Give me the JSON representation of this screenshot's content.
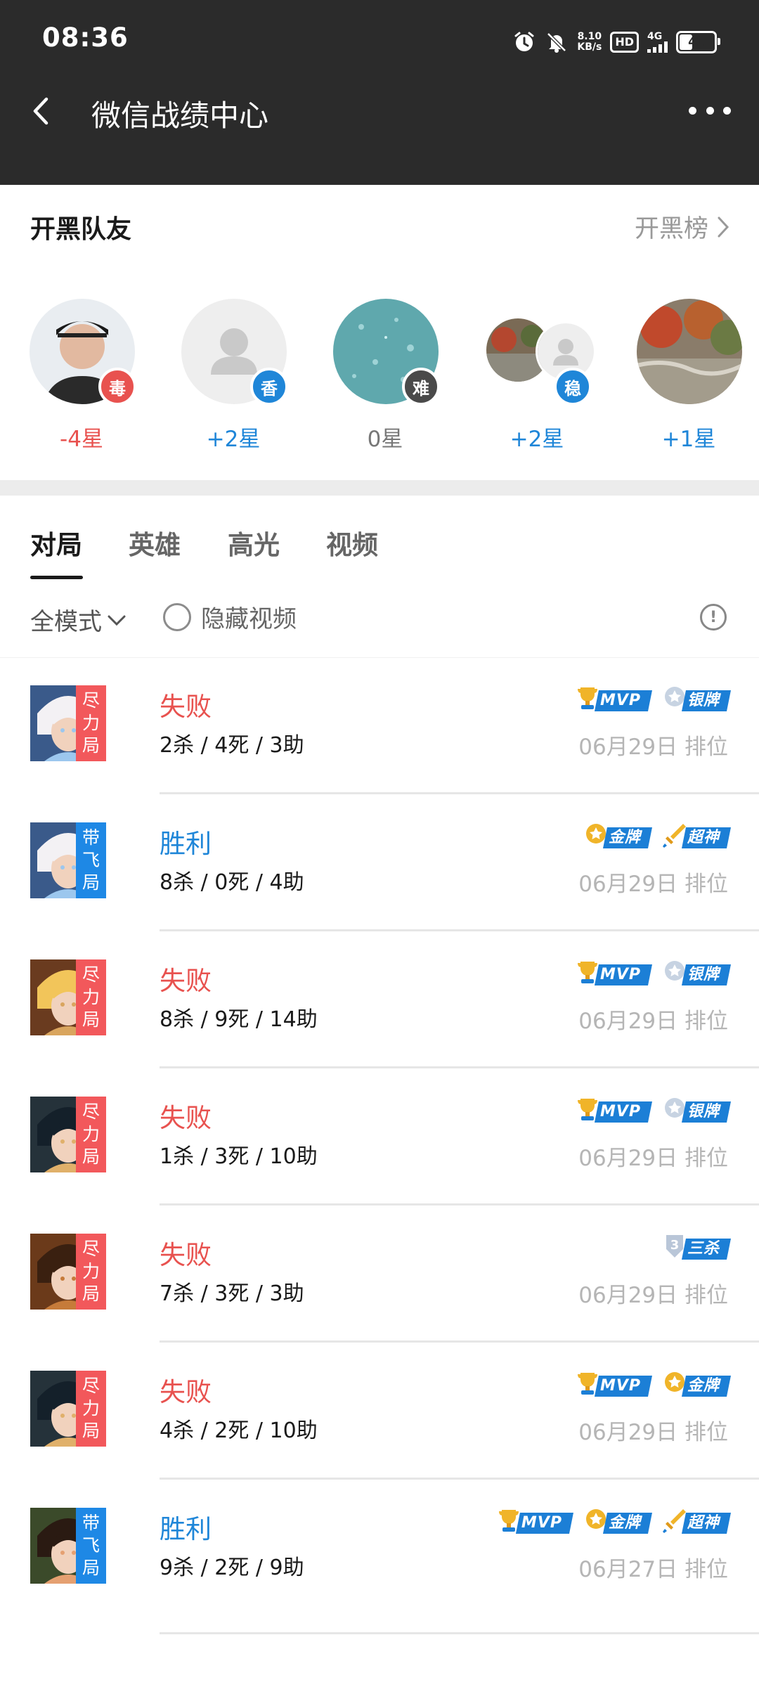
{
  "status_bar": {
    "time": "08:36",
    "net_speed_value": "8.10",
    "net_speed_unit": "KB/s",
    "hd": "HD",
    "network": "4G",
    "battery": "41",
    "battery_level_percent": 41
  },
  "nav": {
    "title": "微信战绩中心",
    "back_icon": "back-arrow-icon",
    "more_icon": "more-dots-icon"
  },
  "teammates": {
    "title": "开黑队友",
    "link_label": "开黑榜",
    "items": [
      {
        "badge": "毒",
        "stars": "-4星",
        "tone": "red"
      },
      {
        "badge": "香",
        "stars": "+2星",
        "tone": "blue"
      },
      {
        "badge": "难",
        "stars": "0星",
        "tone": "gray"
      },
      {
        "badge": "稳",
        "stars": "+2星",
        "tone": "blue"
      },
      {
        "badge": "",
        "stars": "+1星",
        "tone": "blue"
      }
    ]
  },
  "tabs": [
    "对局",
    "英雄",
    "高光",
    "视频"
  ],
  "active_tab": 0,
  "filters": {
    "mode_label": "全模式",
    "hide_video_label": "隐藏视频",
    "hide_video_checked": false
  },
  "matches": [
    {
      "tag": [
        "尽",
        "力",
        "局"
      ],
      "tag_color": "red",
      "result": "失败",
      "kda": "2杀 / 4死 / 3助",
      "medals": [
        "MVP",
        "银牌"
      ],
      "meta": "06月29日  排位"
    },
    {
      "tag": [
        "带",
        "飞",
        "局"
      ],
      "tag_color": "blue",
      "result": "胜利",
      "kda": "8杀 / 0死 / 4助",
      "medals": [
        "金牌",
        "超神"
      ],
      "meta": "06月29日  排位"
    },
    {
      "tag": [
        "尽",
        "力",
        "局"
      ],
      "tag_color": "red",
      "result": "失败",
      "kda": "8杀 / 9死 / 14助",
      "medals": [
        "MVP",
        "银牌"
      ],
      "meta": "06月29日  排位"
    },
    {
      "tag": [
        "尽",
        "力",
        "局"
      ],
      "tag_color": "red",
      "result": "失败",
      "kda": "1杀 / 3死 / 10助",
      "medals": [
        "MVP",
        "银牌"
      ],
      "meta": "06月29日  排位"
    },
    {
      "tag": [
        "尽",
        "力",
        "局"
      ],
      "tag_color": "red",
      "result": "失败",
      "kda": "7杀 / 3死 / 3助",
      "medals": [
        "三杀"
      ],
      "meta": "06月29日  排位"
    },
    {
      "tag": [
        "尽",
        "力",
        "局"
      ],
      "tag_color": "red",
      "result": "失败",
      "kda": "4杀 / 2死 / 10助",
      "medals": [
        "MVP",
        "金牌"
      ],
      "meta": "06月29日  排位"
    },
    {
      "tag": [
        "带",
        "飞",
        "局"
      ],
      "tag_color": "blue",
      "result": "胜利",
      "kda": "9杀 / 2死 / 9助",
      "medals": [
        "MVP",
        "金牌",
        "超神"
      ],
      "meta": "06月27日  排位"
    }
  ],
  "colors": {
    "header_bg": "#2b2b2b",
    "loss": "#e8524f",
    "win": "#1f86d8",
    "medal_blue": "#1c7fd6",
    "meta_gray": "#b5b5b5"
  }
}
